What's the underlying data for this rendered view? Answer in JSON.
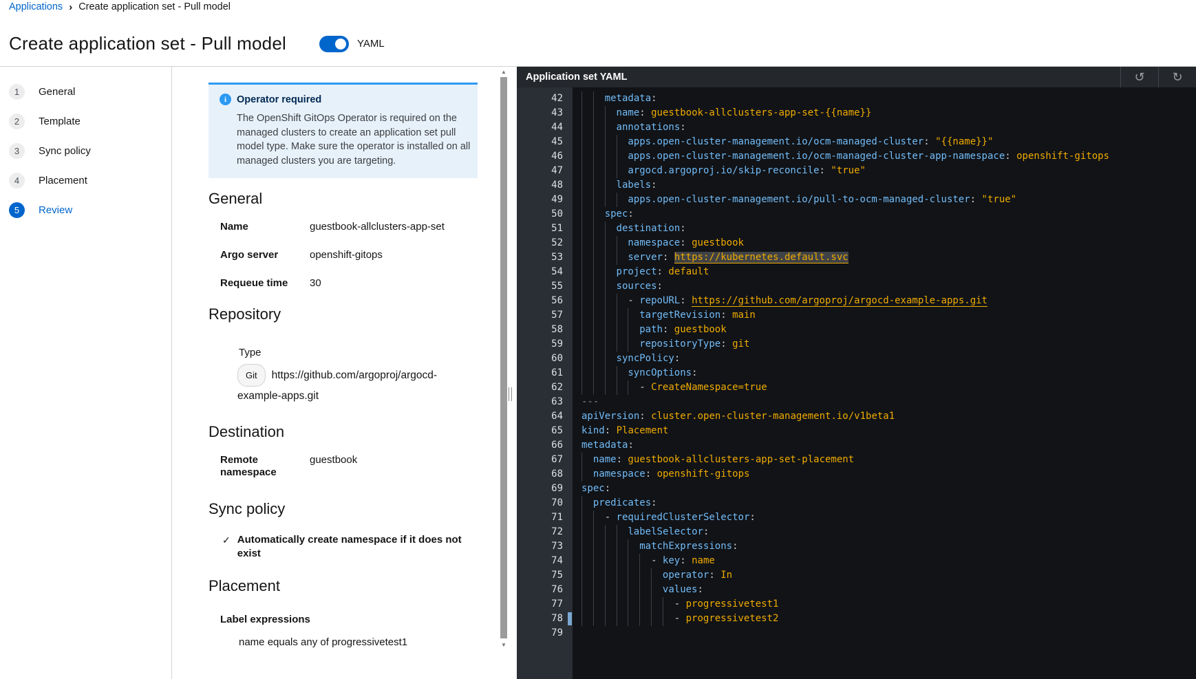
{
  "breadcrumb": {
    "link": "Applications",
    "current": "Create application set - Pull model"
  },
  "header": {
    "title": "Create application set - Pull model",
    "toggle_label": "YAML",
    "toggle_on": true
  },
  "wizard": {
    "steps": [
      {
        "num": "1",
        "label": "General",
        "active": false
      },
      {
        "num": "2",
        "label": "Template",
        "active": false
      },
      {
        "num": "3",
        "label": "Sync policy",
        "active": false
      },
      {
        "num": "4",
        "label": "Placement",
        "active": false
      },
      {
        "num": "5",
        "label": "Review",
        "active": true
      }
    ]
  },
  "review": {
    "alert": {
      "title": "Operator required",
      "body": "The OpenShift GitOps Operator is required on the managed clusters to create an application set pull model type. Make sure the operator is installed on all managed clusters you are targeting."
    },
    "general": {
      "heading": "General",
      "rows": [
        {
          "label": "Name",
          "value": "guestbook-allclusters-app-set"
        },
        {
          "label": "Argo server",
          "value": "openshift-gitops"
        },
        {
          "label": "Requeue time",
          "value": "30"
        }
      ]
    },
    "repository": {
      "heading": "Repository",
      "type_label": "Type",
      "type_badge": "Git",
      "url": "https://github.com/argoproj/argocd-example-apps.git"
    },
    "destination": {
      "heading": "Destination",
      "rows": [
        {
          "label": "Remote namespace",
          "value": "guestbook"
        }
      ]
    },
    "sync_policy": {
      "heading": "Sync policy",
      "items": [
        "Automatically create namespace if it does not exist"
      ]
    },
    "placement": {
      "heading": "Placement",
      "label": "Label expressions",
      "expression": "name equals any of progressivetest1"
    }
  },
  "editor": {
    "panel_title": "Application set YAML",
    "undo_icon": "↺",
    "redo_icon": "↻",
    "cursor_line": 78,
    "colors": {
      "key": "#73bcf7",
      "value": "#f0ab00",
      "plain": "#d2d2d2",
      "separator": "#8a8a8a",
      "background": "#111317",
      "gutter": "#2a2e35",
      "header_bar": "#24272b",
      "accent": "#0066cc"
    },
    "lines": [
      {
        "n": 42,
        "i": 4,
        "s": [
          [
            "k",
            "metadata"
          ],
          [
            "p",
            ":"
          ]
        ]
      },
      {
        "n": 43,
        "i": 6,
        "s": [
          [
            "k",
            "name"
          ],
          [
            "p",
            ":"
          ],
          [
            "v",
            " guestbook-allclusters-app-set-{{name}}"
          ]
        ]
      },
      {
        "n": 44,
        "i": 6,
        "s": [
          [
            "k",
            "annotations"
          ],
          [
            "p",
            ":"
          ]
        ]
      },
      {
        "n": 45,
        "i": 8,
        "s": [
          [
            "k",
            "apps.open-cluster-management.io/ocm-managed-cluster"
          ],
          [
            "p",
            ":"
          ],
          [
            "v",
            " \"{{name}}\""
          ]
        ]
      },
      {
        "n": 46,
        "i": 8,
        "s": [
          [
            "k",
            "apps.open-cluster-management.io/ocm-managed-cluster-app-namespace"
          ],
          [
            "p",
            ":"
          ],
          [
            "v",
            " openshift-gitops"
          ]
        ]
      },
      {
        "n": 47,
        "i": 8,
        "s": [
          [
            "k",
            "argocd.argoproj.io/skip-reconcile"
          ],
          [
            "p",
            ":"
          ],
          [
            "v",
            " \"true\""
          ]
        ]
      },
      {
        "n": 48,
        "i": 6,
        "s": [
          [
            "k",
            "labels"
          ],
          [
            "p",
            ":"
          ]
        ]
      },
      {
        "n": 49,
        "i": 8,
        "s": [
          [
            "k",
            "apps.open-cluster-management.io/pull-to-ocm-managed-cluster"
          ],
          [
            "p",
            ":"
          ],
          [
            "v",
            " \"true\""
          ]
        ]
      },
      {
        "n": 50,
        "i": 4,
        "s": [
          [
            "k",
            "spec"
          ],
          [
            "p",
            ":"
          ]
        ]
      },
      {
        "n": 51,
        "i": 6,
        "s": [
          [
            "k",
            "destination"
          ],
          [
            "p",
            ":"
          ]
        ]
      },
      {
        "n": 52,
        "i": 8,
        "s": [
          [
            "k",
            "namespace"
          ],
          [
            "p",
            ":"
          ],
          [
            "v",
            " guestbook"
          ]
        ]
      },
      {
        "n": 53,
        "i": 8,
        "s": [
          [
            "k",
            "server"
          ],
          [
            "p",
            ": "
          ],
          [
            "h",
            "https://kubernetes.default.svc"
          ]
        ]
      },
      {
        "n": 54,
        "i": 6,
        "s": [
          [
            "k",
            "project"
          ],
          [
            "p",
            ":"
          ],
          [
            "v",
            " default"
          ]
        ]
      },
      {
        "n": 55,
        "i": 6,
        "s": [
          [
            "k",
            "sources"
          ],
          [
            "p",
            ":"
          ]
        ]
      },
      {
        "n": 56,
        "i": 8,
        "s": [
          [
            "p",
            "- "
          ],
          [
            "k",
            "repoURL"
          ],
          [
            "p",
            ": "
          ],
          [
            "l",
            "https://github.com/argoproj/argocd-example-apps.git"
          ]
        ]
      },
      {
        "n": 57,
        "i": 10,
        "s": [
          [
            "k",
            "targetRevision"
          ],
          [
            "p",
            ":"
          ],
          [
            "v",
            " main"
          ]
        ]
      },
      {
        "n": 58,
        "i": 10,
        "s": [
          [
            "k",
            "path"
          ],
          [
            "p",
            ":"
          ],
          [
            "v",
            " guestbook"
          ]
        ]
      },
      {
        "n": 59,
        "i": 10,
        "s": [
          [
            "k",
            "repositoryType"
          ],
          [
            "p",
            ":"
          ],
          [
            "v",
            " git"
          ]
        ]
      },
      {
        "n": 60,
        "i": 6,
        "s": [
          [
            "k",
            "syncPolicy"
          ],
          [
            "p",
            ":"
          ]
        ]
      },
      {
        "n": 61,
        "i": 8,
        "s": [
          [
            "k",
            "syncOptions"
          ],
          [
            "p",
            ":"
          ]
        ]
      },
      {
        "n": 62,
        "i": 10,
        "s": [
          [
            "p",
            "- "
          ],
          [
            "v",
            "CreateNamespace=true"
          ]
        ]
      },
      {
        "n": 63,
        "i": 0,
        "s": [
          [
            "s",
            "---"
          ]
        ]
      },
      {
        "n": 64,
        "i": 0,
        "s": [
          [
            "k",
            "apiVersion"
          ],
          [
            "p",
            ":"
          ],
          [
            "v",
            " cluster.open-cluster-management.io/v1beta1"
          ]
        ]
      },
      {
        "n": 65,
        "i": 0,
        "s": [
          [
            "k",
            "kind"
          ],
          [
            "p",
            ":"
          ],
          [
            "v",
            " Placement"
          ]
        ]
      },
      {
        "n": 66,
        "i": 0,
        "s": [
          [
            "k",
            "metadata"
          ],
          [
            "p",
            ":"
          ]
        ]
      },
      {
        "n": 67,
        "i": 2,
        "s": [
          [
            "k",
            "name"
          ],
          [
            "p",
            ":"
          ],
          [
            "v",
            " guestbook-allclusters-app-set-placement"
          ]
        ]
      },
      {
        "n": 68,
        "i": 2,
        "s": [
          [
            "k",
            "namespace"
          ],
          [
            "p",
            ":"
          ],
          [
            "v",
            " openshift-gitops"
          ]
        ]
      },
      {
        "n": 69,
        "i": 0,
        "s": [
          [
            "k",
            "spec"
          ],
          [
            "p",
            ":"
          ]
        ]
      },
      {
        "n": 70,
        "i": 2,
        "s": [
          [
            "k",
            "predicates"
          ],
          [
            "p",
            ":"
          ]
        ]
      },
      {
        "n": 71,
        "i": 4,
        "s": [
          [
            "p",
            "- "
          ],
          [
            "k",
            "requiredClusterSelector"
          ],
          [
            "p",
            ":"
          ]
        ]
      },
      {
        "n": 72,
        "i": 8,
        "s": [
          [
            "k",
            "labelSelector"
          ],
          [
            "p",
            ":"
          ]
        ]
      },
      {
        "n": 73,
        "i": 10,
        "s": [
          [
            "k",
            "matchExpressions"
          ],
          [
            "p",
            ":"
          ]
        ]
      },
      {
        "n": 74,
        "i": 12,
        "s": [
          [
            "p",
            "- "
          ],
          [
            "k",
            "key"
          ],
          [
            "p",
            ":"
          ],
          [
            "v",
            " name"
          ]
        ]
      },
      {
        "n": 75,
        "i": 14,
        "s": [
          [
            "k",
            "operator"
          ],
          [
            "p",
            ":"
          ],
          [
            "v",
            " In"
          ]
        ]
      },
      {
        "n": 76,
        "i": 14,
        "s": [
          [
            "k",
            "values"
          ],
          [
            "p",
            ":"
          ]
        ]
      },
      {
        "n": 77,
        "i": 16,
        "s": [
          [
            "p",
            "- "
          ],
          [
            "v",
            "progressivetest1"
          ]
        ]
      },
      {
        "n": 78,
        "i": 16,
        "s": [
          [
            "p",
            "- "
          ],
          [
            "v",
            "progressivetest2"
          ]
        ]
      },
      {
        "n": 79,
        "i": 0,
        "s": []
      }
    ]
  }
}
